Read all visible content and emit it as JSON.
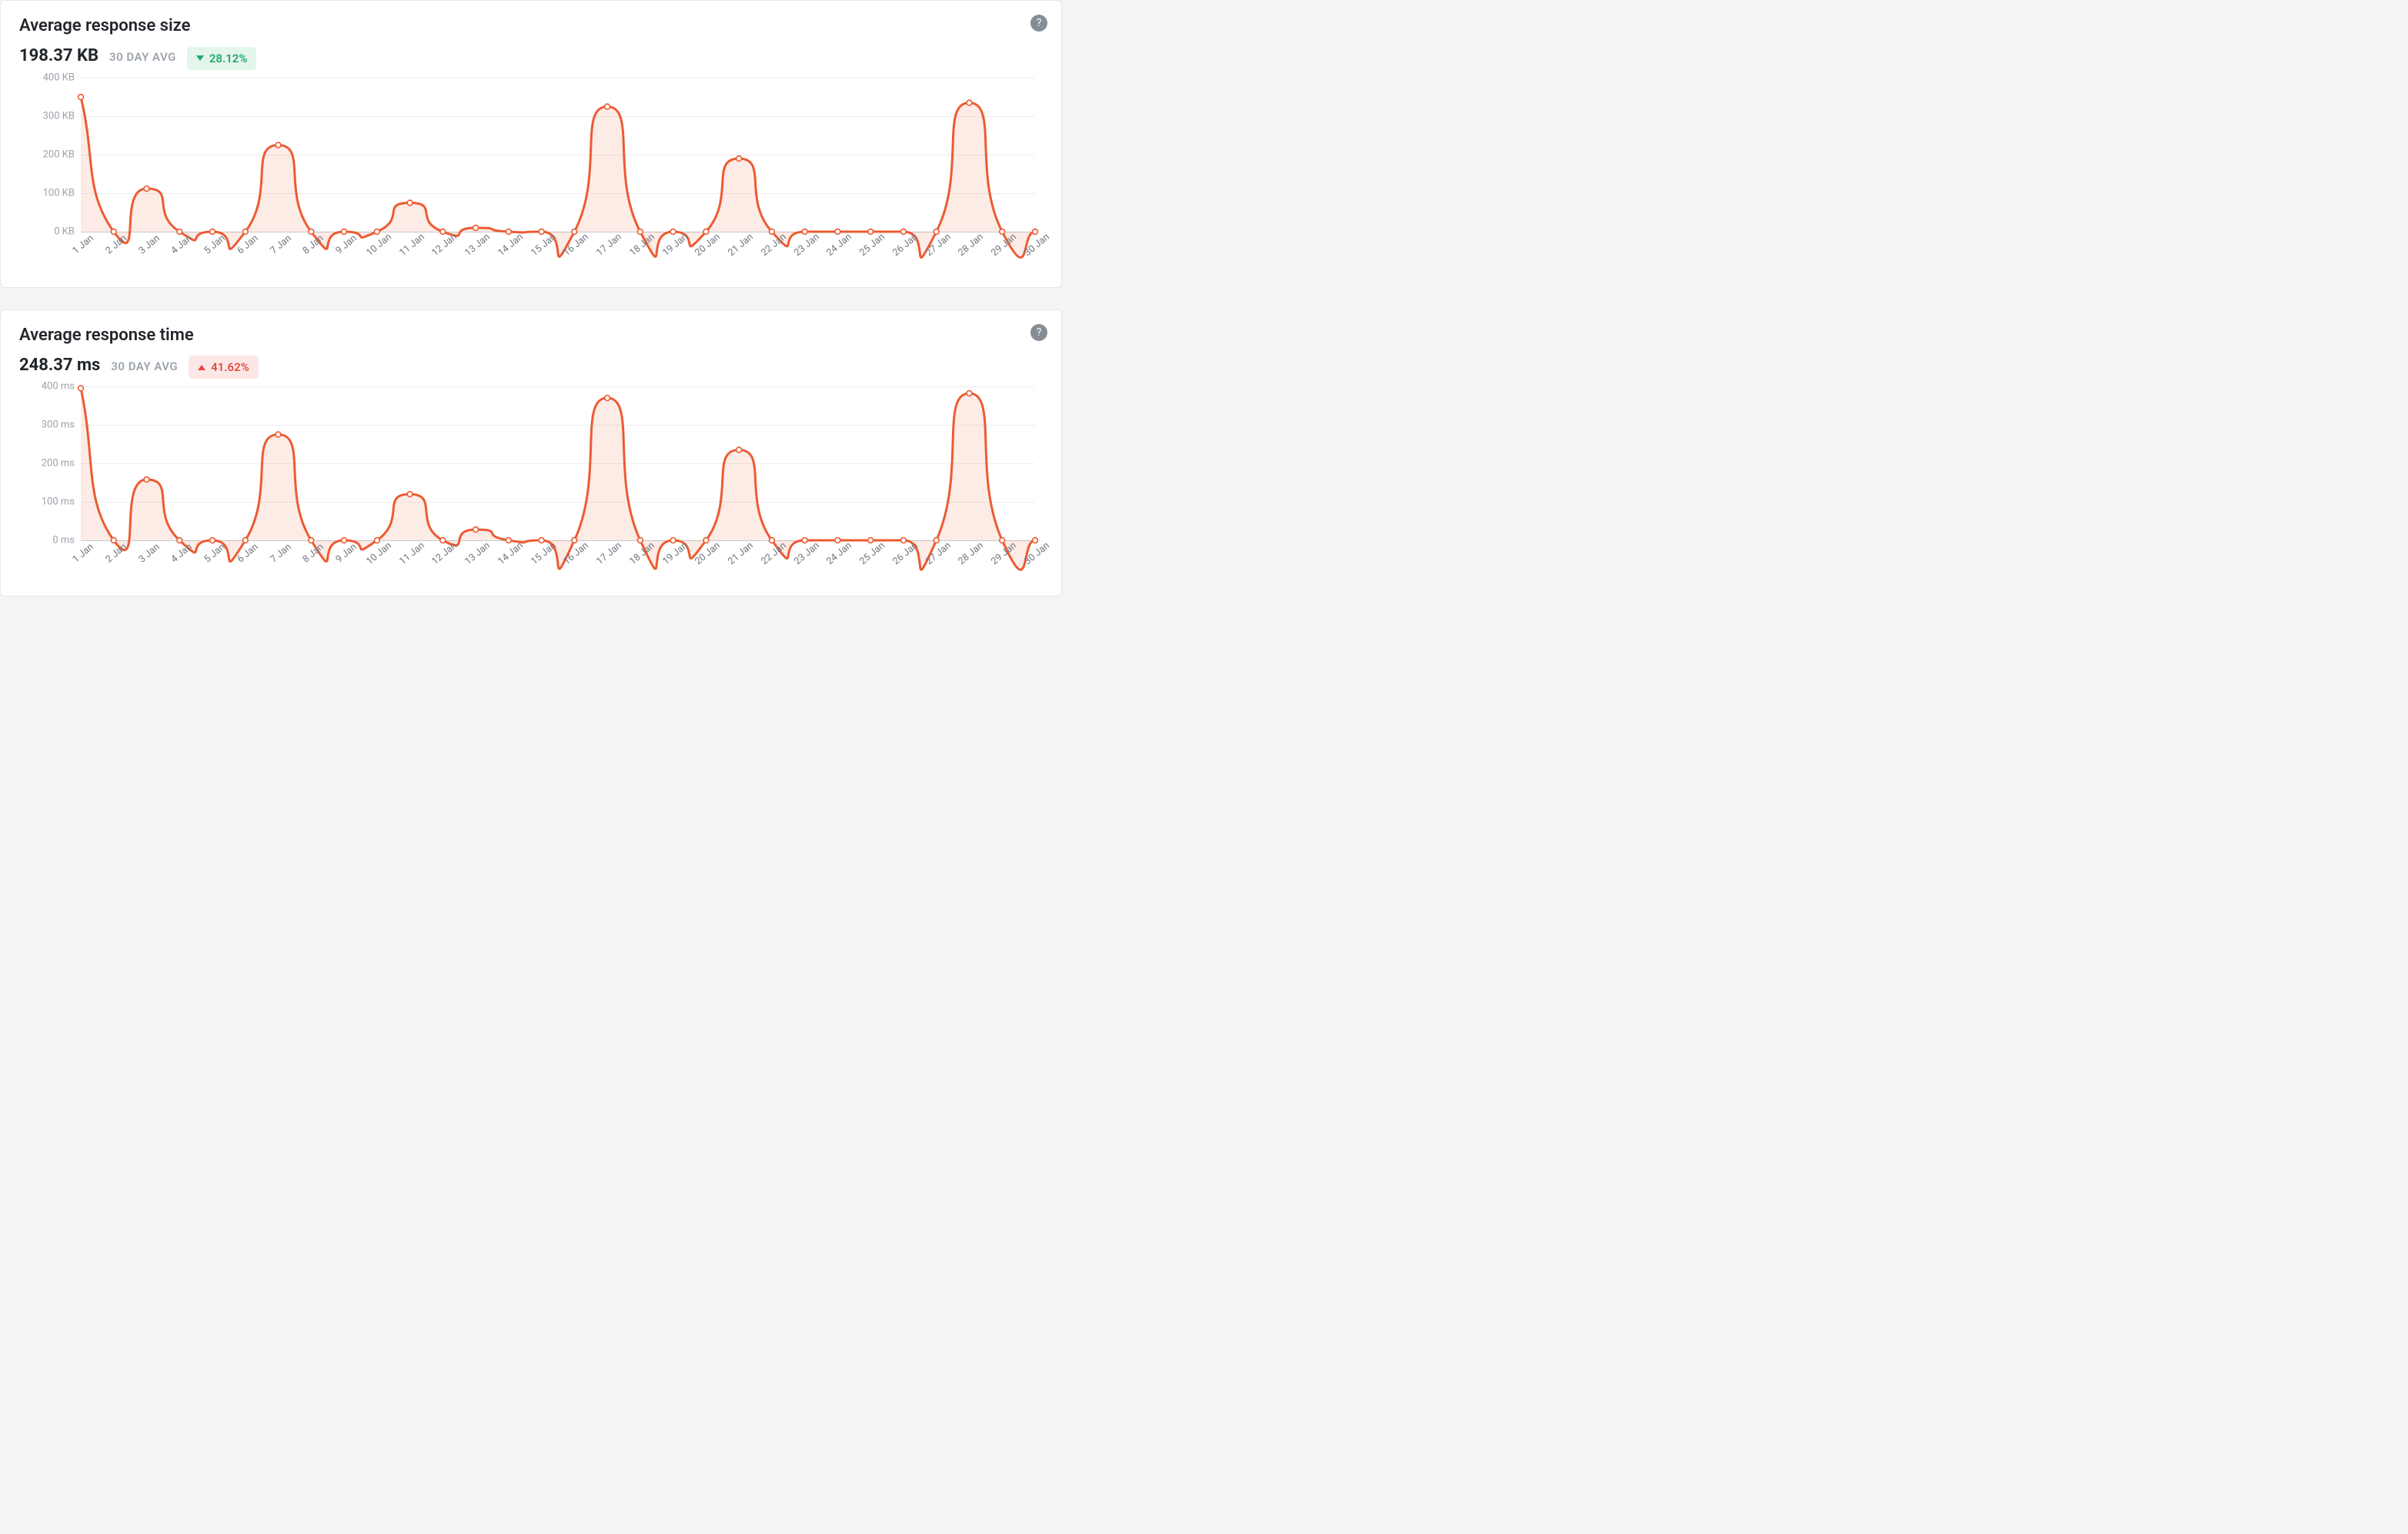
{
  "cards": [
    {
      "id": "response-size",
      "title": "Average response size",
      "value": "198.37 KB",
      "period": "30 DAY AVG",
      "delta": {
        "direction": "down",
        "text": "28.12%",
        "tone": "green"
      },
      "yticks": [
        "0 KB",
        "100 KB",
        "200 KB",
        "300 KB",
        "400 KB"
      ],
      "color": "#ec5b32"
    },
    {
      "id": "response-time",
      "title": "Average response time",
      "value": "248.37 ms",
      "period": "30 DAY AVG",
      "delta": {
        "direction": "up",
        "text": "41.62%",
        "tone": "red"
      },
      "yticks": [
        "0 ms",
        "100 ms",
        "200 ms",
        "300 ms",
        "400 ms"
      ],
      "color": "#ec5b32"
    }
  ],
  "chart_data": [
    {
      "type": "area",
      "title": "Average response size",
      "xlabel": "",
      "ylabel": "",
      "ylim": [
        0,
        400
      ],
      "unit": "KB",
      "categories": [
        "1 Jan",
        "2 Jan",
        "3 Jan",
        "4 Jan",
        "5 Jan",
        "6 Jan",
        "7 Jan",
        "8 Jan",
        "9 Jan",
        "10 Jan",
        "11 Jan",
        "12 Jan",
        "13 Jan",
        "14 Jan",
        "15 Jan",
        "16 Jan",
        "17 Jan",
        "18 Jan",
        "19 Jan",
        "20 Jan",
        "21 Jan",
        "22 Jan",
        "23 Jan",
        "24 Jan",
        "25 Jan",
        "26 Jan",
        "27 Jan",
        "28 Jan",
        "29 Jan",
        "30 Jan"
      ],
      "values": [
        350,
        0,
        112,
        0,
        0,
        0,
        225,
        0,
        0,
        0,
        75,
        0,
        10,
        0,
        0,
        0,
        325,
        0,
        0,
        0,
        190,
        0,
        0,
        0,
        0,
        0,
        0,
        335,
        0,
        0
      ]
    },
    {
      "type": "area",
      "title": "Average response time",
      "xlabel": "",
      "ylabel": "",
      "ylim": [
        0,
        400
      ],
      "unit": "ms",
      "categories": [
        "1 Jan",
        "2 Jan",
        "3 Jan",
        "4 Jan",
        "5 Jan",
        "6 Jan",
        "7 Jan",
        "8 Jan",
        "9 Jan",
        "10 Jan",
        "11 Jan",
        "12 Jan",
        "13 Jan",
        "14 Jan",
        "15 Jan",
        "16 Jan",
        "17 Jan",
        "18 Jan",
        "19 Jan",
        "20 Jan",
        "21 Jan",
        "22 Jan",
        "23 Jan",
        "24 Jan",
        "25 Jan",
        "26 Jan",
        "27 Jan",
        "28 Jan",
        "29 Jan",
        "30 Jan"
      ],
      "values": [
        395,
        0,
        158,
        0,
        0,
        0,
        275,
        0,
        0,
        0,
        120,
        0,
        28,
        0,
        0,
        0,
        370,
        0,
        0,
        0,
        235,
        0,
        0,
        0,
        0,
        0,
        0,
        382,
        0,
        0
      ]
    }
  ]
}
